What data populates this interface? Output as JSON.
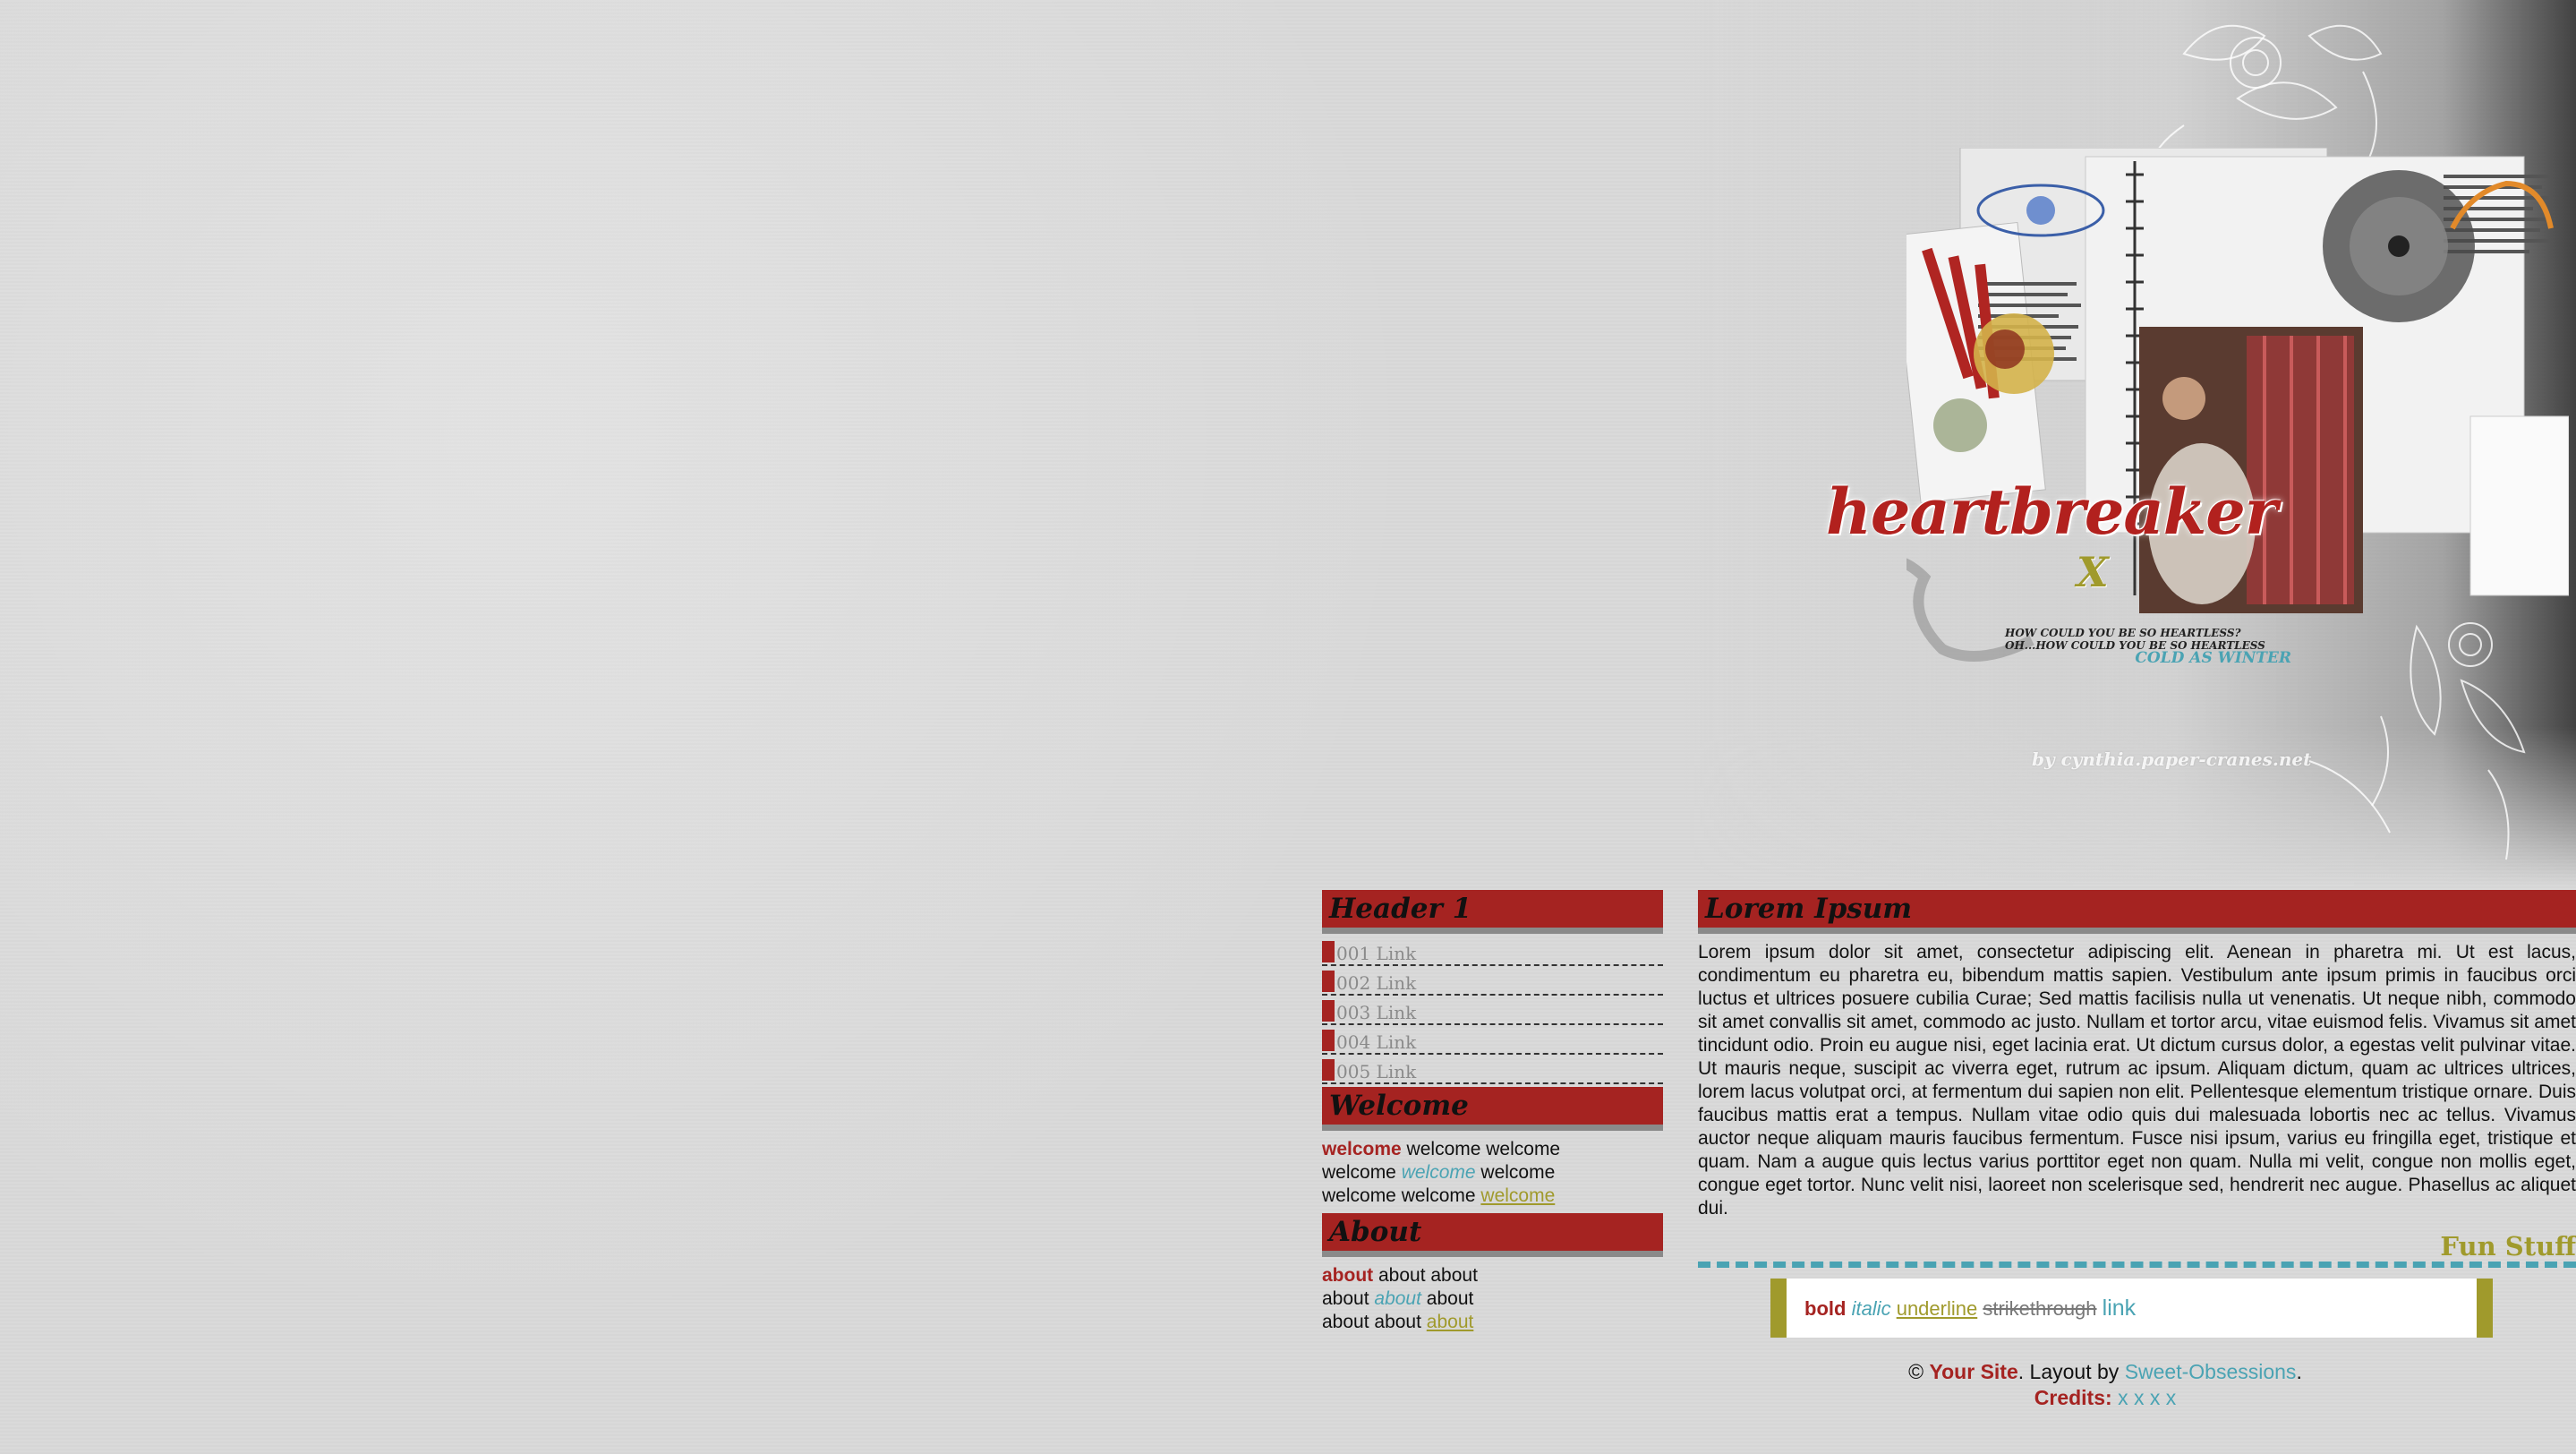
{
  "banner": {
    "headline": "heartbreaker",
    "headline_mark": "X",
    "tagline_line1": "HOW COULD YOU BE SO HEARTLESS?",
    "tagline_line2": "OH...HOW COULD YOU BE SO HEARTLESS",
    "tagline_line3": "COLD AS WINTER",
    "credit_mark": "by cynthia.paper-cranes.net"
  },
  "sidebar": {
    "header1": "Header 1",
    "links": [
      "001 Link",
      "002 Link",
      "003 Link",
      "004 Link",
      "005 Link"
    ],
    "welcome_header": "Welcome",
    "welcome_bold": "welcome",
    "welcome_t1": " welcome welcome",
    "welcome_t2": "welcome ",
    "welcome_italic": "welcome",
    "welcome_t3": " welcome",
    "welcome_t4": "welcome welcome ",
    "welcome_underline": "welcome",
    "about_header": "About",
    "about_bold": "about",
    "about_t1": " about about",
    "about_t2": "about ",
    "about_italic": "about",
    "about_t3": " about",
    "about_t4": "about about ",
    "about_underline": "about"
  },
  "main": {
    "header": "Lorem Ipsum",
    "body": "Lorem ipsum dolor sit amet, consectetur adipiscing elit. Aenean in pharetra mi. Ut est lacus, condimentum eu pharetra eu, bibendum mattis sapien. Vestibulum ante ipsum primis in faucibus orci luctus et ultrices posuere cubilia Curae; Sed mattis facilisis nulla ut venenatis. Ut neque nibh, commodo sit amet convallis sit amet, commodo ac justo. Nullam et tortor arcu, vitae euismod felis. Vivamus sit amet tincidunt odio. Proin eu augue nisi, eget lacinia erat. Ut dictum cursus dolor, a egestas velit pulvinar vitae. Ut mauris neque, suscipit ac viverra eget, rutrum ac ipsum. Aliquam dictum, quam ac ultrices ultrices, lorem lacus volutpat orci, at fermentum dui sapien non elit. Pellentesque elementum tristique ornare. Duis faucibus mattis erat a tempus. Nullam vitae odio quis dui malesuada lobortis nec ac tellus. Vivamus auctor neque aliquam mauris faucibus fermentum. Fusce nisi ipsum, varius eu fringilla eget, tristique et quam. Nam a augue quis lectus varius porttitor eget non quam. Nulla mi velit, congue non mollis eget, congue eget tortor. Nunc velit nisi, laoreet non scelerisque sed, hendrerit nec augue. Phasellus ac aliquet dui.",
    "fun_title": "Fun Stuff",
    "demo": {
      "bold": "bold",
      "italic": "italic",
      "underline": "underline",
      "strike": "strikethrough",
      "link": "link"
    },
    "footer": {
      "copyright": "© ",
      "site": "Your Site",
      "layout_prefix": ". Layout by ",
      "layout_link": "Sweet-Obsessions",
      "period": ".",
      "credits_label": "Credits:",
      "credits_links": [
        "x",
        "x",
        "x",
        "x"
      ]
    }
  },
  "colors": {
    "red": "#a52321",
    "teal": "#4aa3b3",
    "olive": "#a09a2c",
    "gray_bar": "#8a8a8a",
    "background": "#d9d9d9"
  },
  "icons": {
    "banner_collage": "collage-artwork",
    "floral_pattern": "floral-lace-decoration"
  }
}
